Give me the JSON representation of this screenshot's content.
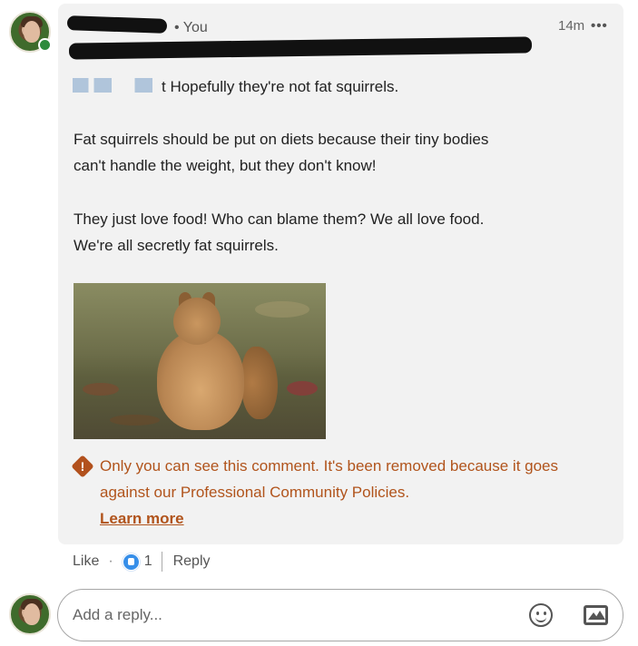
{
  "comment": {
    "author_visibility": "• You",
    "timestamp": "14m",
    "more_icon": "more-horizontal-icon",
    "mention_line_suffix": "t Hopefully they're not fat squirrels.",
    "paragraph_1": "Fat squirrels should be put on diets because their tiny bodies\ncan't handle the weight, but they don't know!",
    "paragraph_2": "They just love food! Who can blame them? We all love food.\nWe're all secretly fat squirrels.",
    "image_subject": "squirrel photo",
    "warning": {
      "icon": "warning-icon",
      "text": "Only you can see this comment. It's been removed because it goes against our Professional Community Policies.",
      "link_label": "Learn more",
      "color": "#b1541c"
    }
  },
  "actions": {
    "like_label": "Like",
    "separator": "·",
    "reaction_count": "1",
    "reply_label": "Reply"
  },
  "reply_box": {
    "placeholder": "Add a reply...",
    "emoji_icon": "emoji-icon",
    "image_icon": "image-icon"
  },
  "colors": {
    "bubble_bg": "#f2f2f2",
    "warning": "#b1541c",
    "like_badge": "#378fe9"
  }
}
